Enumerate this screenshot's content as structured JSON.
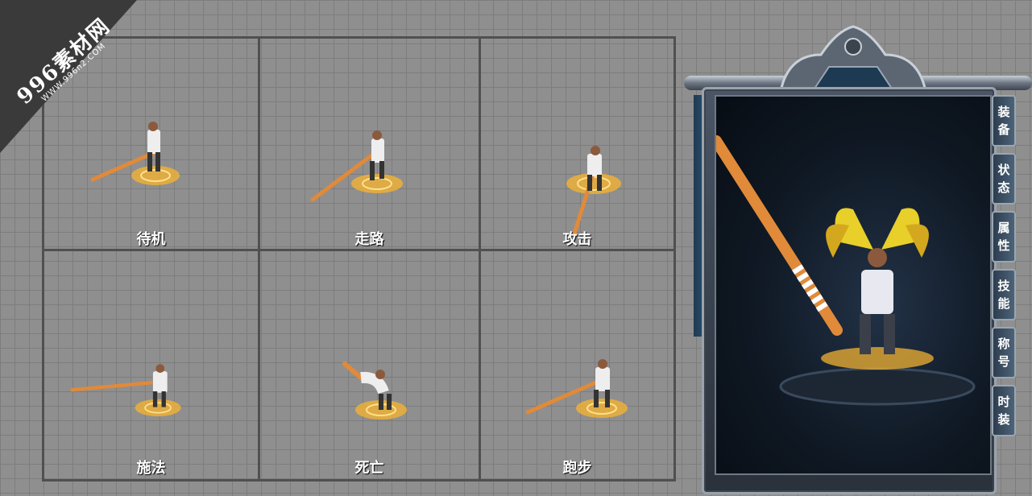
{
  "watermark": {
    "main": "996素材网",
    "sub": "WWW.996n2.COM"
  },
  "animations": [
    {
      "label": "待机"
    },
    {
      "label": "走路"
    },
    {
      "label": "攻击"
    },
    {
      "label": "施法"
    },
    {
      "label": "死亡"
    },
    {
      "label": "跑步"
    }
  ],
  "panel": {
    "tabs": [
      {
        "line1": "装",
        "line2": "备"
      },
      {
        "line1": "状",
        "line2": "态"
      },
      {
        "line1": "属",
        "line2": "性"
      },
      {
        "line1": "技",
        "line2": "能"
      },
      {
        "line1": "称",
        "line2": "号"
      },
      {
        "line1": "时",
        "line2": "装"
      }
    ]
  },
  "colors": {
    "staff": "#e08a3a",
    "glow": "#f2b233",
    "wings": "#e8cf2a"
  }
}
